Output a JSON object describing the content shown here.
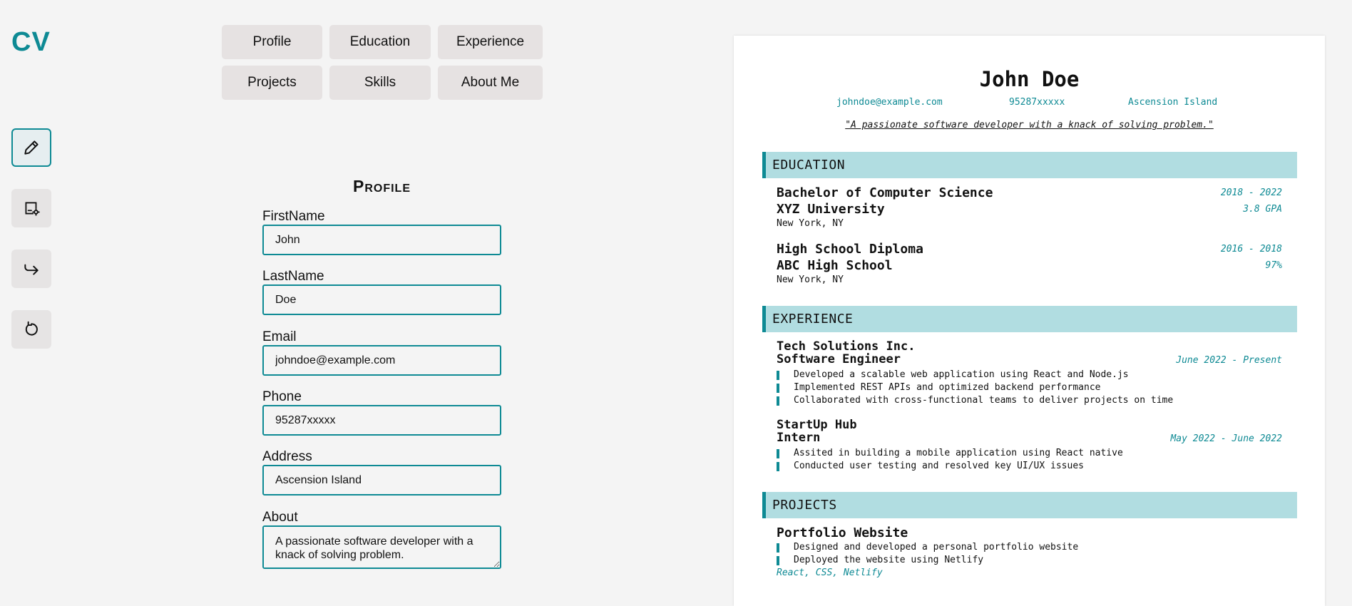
{
  "app": {
    "logo": "CV"
  },
  "rail": [
    {
      "icon": "pencil-icon",
      "name": "edit-button"
    },
    {
      "icon": "template-settings-icon",
      "name": "template-settings-button"
    },
    {
      "icon": "share-icon",
      "name": "export-button"
    },
    {
      "icon": "reset-icon",
      "name": "reset-button"
    }
  ],
  "tabs": [
    "Profile",
    "Education",
    "Experience",
    "Projects",
    "Skills",
    "About Me"
  ],
  "form": {
    "title": "Profile",
    "fields": [
      {
        "label": "FirstName",
        "value": "John"
      },
      {
        "label": "LastName",
        "value": "Doe"
      },
      {
        "label": "Email",
        "value": "johndoe@example.com"
      },
      {
        "label": "Phone",
        "value": "95287xxxxx"
      },
      {
        "label": "Address",
        "value": "Ascension Island"
      },
      {
        "label": "About",
        "value": "A passionate software developer with a knack of solving problem."
      }
    ]
  },
  "resume": {
    "name": "John Doe",
    "email": "johndoe@example.com",
    "phone": "95287xxxxx",
    "address": "Ascension Island",
    "quote": "\"A passionate software developer with a knack of solving problem.\"",
    "education_heading": "EDUCATION",
    "education": [
      {
        "degree": "Bachelor of Computer Science",
        "school": "XYZ University",
        "location": "New York, NY",
        "years": "2018 - 2022",
        "score": "3.8 GPA"
      },
      {
        "degree": "High School Diploma",
        "school": "ABC High School",
        "location": "New York, NY",
        "years": "2016 - 2018",
        "score": "97%"
      }
    ],
    "experience_heading": "EXPERIENCE",
    "experience": [
      {
        "company": "Tech Solutions Inc.",
        "role": "Software Engineer",
        "dates": "June 2022 - Present",
        "points": [
          "Developed a scalable web application using React and Node.js",
          "Implemented REST APIs and optimized backend performance",
          "Collaborated with cross-functional teams to deliver projects on time"
        ]
      },
      {
        "company": "StartUp Hub",
        "role": "Intern",
        "dates": "May 2022 - June 2022",
        "points": [
          "Assited in building a mobile application using React native",
          "Conducted user testing and resolved key UI/UX issues"
        ]
      }
    ],
    "projects_heading": "PROJECTS",
    "projects": [
      {
        "title": "Portfolio Website",
        "points": [
          "Designed and developed a personal portfolio website",
          "Deployed the website using Netlify"
        ],
        "tech": "React, CSS, Netlify"
      }
    ]
  },
  "colors": {
    "accent": "#0e8a94",
    "section_bg": "#b1dde1",
    "tab_bg": "#e6e2e2",
    "page_bg": "#f4f4f4"
  }
}
